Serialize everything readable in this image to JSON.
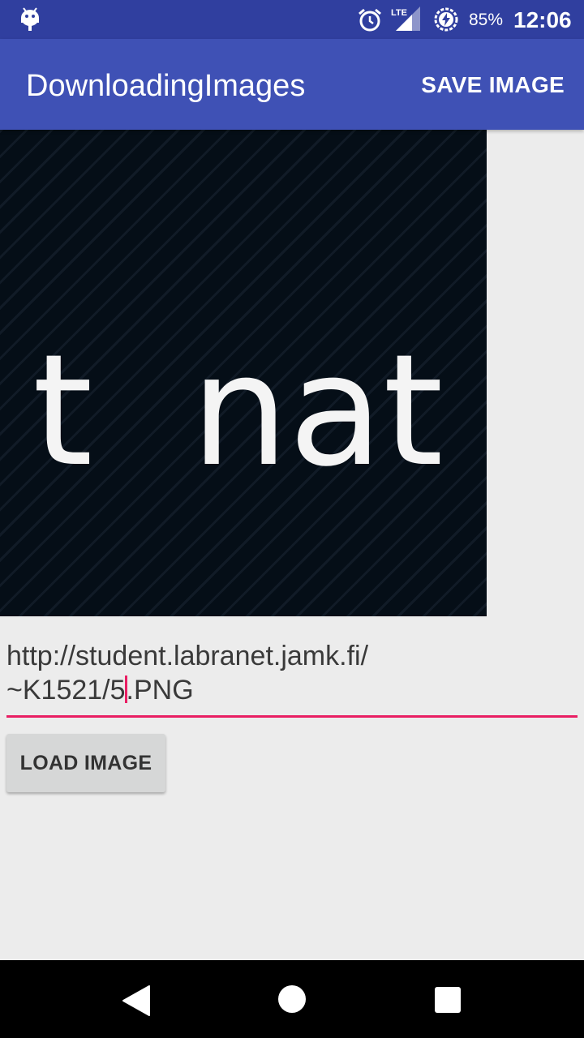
{
  "status_bar": {
    "battery_percent": "85%",
    "time": "12:06",
    "network_label": "LTE",
    "icons": [
      "android-icon",
      "alarm-icon",
      "lte-signal-icon",
      "battery-saver-icon"
    ]
  },
  "app_bar": {
    "title": "DownloadingImages",
    "action_label": "SAVE IMAGE"
  },
  "image_view": {
    "text": "t  nat"
  },
  "url_input": {
    "value_line1": "http://student.labranet.jamk.fi/",
    "value_line2_before_cursor": "~K1521/5",
    "value_line2_after_cursor": ".PNG",
    "accent_color": "#e91e63"
  },
  "load_button": {
    "label": "LOAD IMAGE"
  },
  "nav_bar": {
    "icons": [
      "back-icon",
      "home-icon",
      "recents-icon"
    ]
  },
  "colors": {
    "primary_dark": "#303f9f",
    "primary": "#3f51b5",
    "background": "#ececec"
  }
}
